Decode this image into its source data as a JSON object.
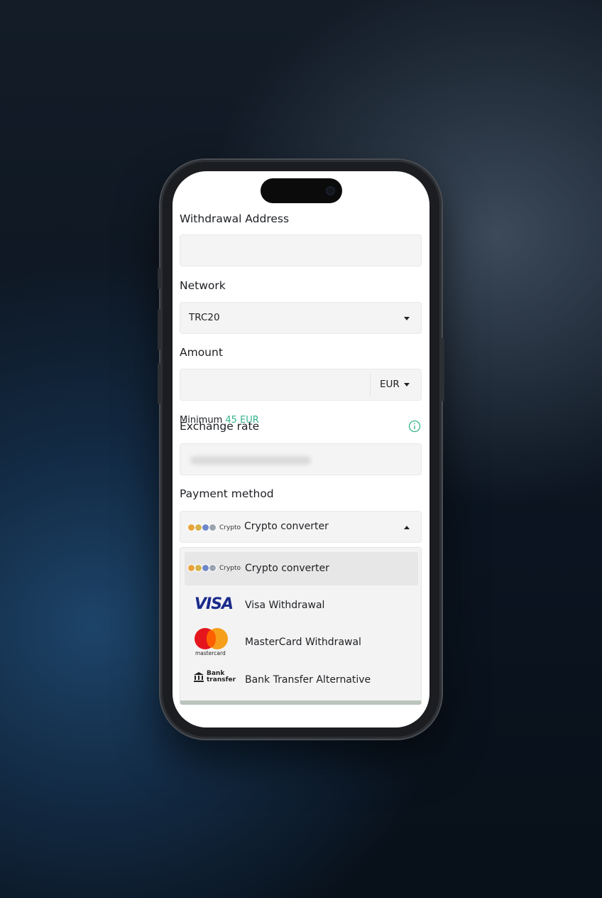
{
  "form": {
    "withdrawal_address": {
      "label": "Withdrawal Address",
      "value": ""
    },
    "network": {
      "label": "Network",
      "value": "TRC20"
    },
    "amount": {
      "label": "Amount",
      "value": "",
      "currency": "EUR"
    },
    "minimum": {
      "label": "Minimum",
      "value": "45 EUR"
    },
    "exchange_rate": {
      "label": "Exchange rate",
      "value": ""
    },
    "payment_method": {
      "label": "Payment method",
      "selected": {
        "logo_text": "Crypto",
        "label": "Crypto converter"
      },
      "options": [
        {
          "logo": "crypto-logo",
          "logo_text": "Crypto",
          "label": "Crypto converter",
          "selected": true
        },
        {
          "logo": "visa-logo",
          "logo_text": "VISA",
          "label": "Visa Withdrawal"
        },
        {
          "logo": "mastercard-logo",
          "logo_text": "mastercard",
          "label": "MasterCard Withdrawal"
        },
        {
          "logo": "bank-transfer-logo",
          "logo_text": "Bank transfer",
          "label": "Bank Transfer Alternative"
        }
      ]
    }
  },
  "colors": {
    "accent_green": "#34b38c",
    "field_bg": "#f4f4f4",
    "visa_blue": "#1a2a8c",
    "mc_red": "#e5151d",
    "mc_orange": "#f59f1b"
  }
}
